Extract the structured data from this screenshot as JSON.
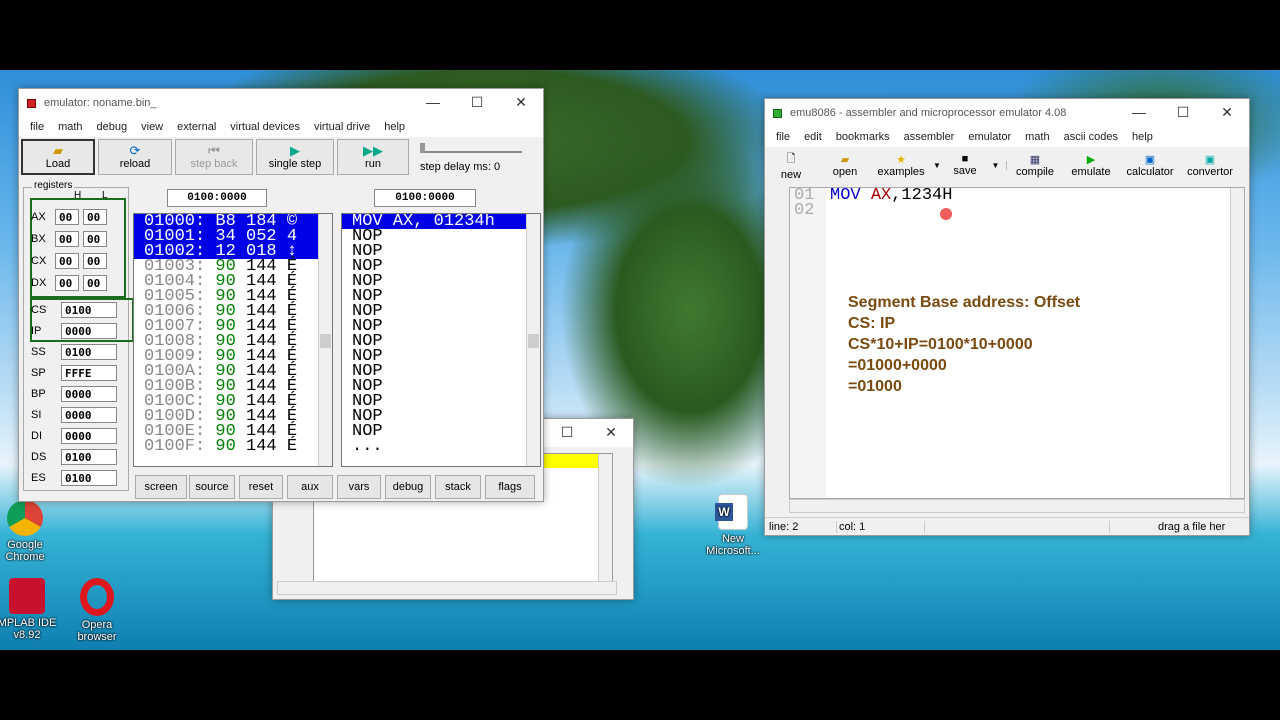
{
  "emulator": {
    "title": "emulator: noname.bin_",
    "menu": [
      "file",
      "math",
      "debug",
      "view",
      "external",
      "virtual devices",
      "virtual drive",
      "help"
    ],
    "toolbar": {
      "load": "Load",
      "reload": "reload",
      "step_back": "step back",
      "single_step": "single step",
      "run": "run",
      "step_delay": "step delay ms: 0"
    },
    "registers_label": "registers",
    "col_h": "H",
    "col_l": "L",
    "registers": {
      "ax": {
        "name": "AX",
        "h": "00",
        "l": "00"
      },
      "bx": {
        "name": "BX",
        "h": "00",
        "l": "00"
      },
      "cx": {
        "name": "CX",
        "h": "00",
        "l": "00"
      },
      "dx": {
        "name": "DX",
        "h": "00",
        "l": "00"
      },
      "cs": {
        "name": "CS",
        "v": "0100"
      },
      "ip": {
        "name": "IP",
        "v": "0000"
      },
      "ss": {
        "name": "SS",
        "v": "0100"
      },
      "sp": {
        "name": "SP",
        "v": "FFFE"
      },
      "bp": {
        "name": "BP",
        "v": "0000"
      },
      "si": {
        "name": "SI",
        "v": "0000"
      },
      "di": {
        "name": "DI",
        "v": "0000"
      },
      "ds": {
        "name": "DS",
        "v": "0100"
      },
      "es": {
        "name": "ES",
        "v": "0100"
      }
    },
    "mem_address": "0100:0000",
    "dis_address": "0100:0000",
    "memory": [
      {
        "addr": "01000:",
        "hex": "B8",
        "dec": "184",
        "ch": "©"
      },
      {
        "addr": "01001:",
        "hex": "34",
        "dec": "052",
        "ch": "4"
      },
      {
        "addr": "01002:",
        "hex": "12",
        "dec": "018",
        "ch": "↕"
      },
      {
        "addr": "01003:",
        "hex": "90",
        "dec": "144",
        "ch": "É"
      },
      {
        "addr": "01004:",
        "hex": "90",
        "dec": "144",
        "ch": "É"
      },
      {
        "addr": "01005:",
        "hex": "90",
        "dec": "144",
        "ch": "É"
      },
      {
        "addr": "01006:",
        "hex": "90",
        "dec": "144",
        "ch": "É"
      },
      {
        "addr": "01007:",
        "hex": "90",
        "dec": "144",
        "ch": "É"
      },
      {
        "addr": "01008:",
        "hex": "90",
        "dec": "144",
        "ch": "É"
      },
      {
        "addr": "01009:",
        "hex": "90",
        "dec": "144",
        "ch": "É"
      },
      {
        "addr": "0100A:",
        "hex": "90",
        "dec": "144",
        "ch": "É"
      },
      {
        "addr": "0100B:",
        "hex": "90",
        "dec": "144",
        "ch": "É"
      },
      {
        "addr": "0100C:",
        "hex": "90",
        "dec": "144",
        "ch": "É"
      },
      {
        "addr": "0100D:",
        "hex": "90",
        "dec": "144",
        "ch": "É"
      },
      {
        "addr": "0100E:",
        "hex": "90",
        "dec": "144",
        "ch": "É"
      },
      {
        "addr": "0100F:",
        "hex": "90",
        "dec": "144",
        "ch": "É"
      }
    ],
    "disassembly": [
      "MOV AX, 01234h",
      "NOP",
      "NOP",
      "NOP",
      "NOP",
      "NOP",
      "NOP",
      "NOP",
      "NOP",
      "NOP",
      "NOP",
      "NOP",
      "NOP",
      "NOP",
      "NOP",
      "..."
    ],
    "bottom_buttons": [
      "screen",
      "source",
      "reset",
      "aux",
      "vars",
      "debug",
      "stack",
      "flags"
    ]
  },
  "editor": {
    "title": "emu8086 - assembler and microprocessor emulator 4.08",
    "menu": [
      "file",
      "edit",
      "bookmarks",
      "assembler",
      "emulator",
      "math",
      "ascii codes",
      "help"
    ],
    "toolbar": {
      "new": "new",
      "open": "open",
      "examples": "examples",
      "save": "save",
      "compile": "compile",
      "emulate": "emulate",
      "calculator": "calculator",
      "convertor": "convertor"
    },
    "line_numbers": [
      "01",
      "02"
    ],
    "code": {
      "mov": "MOV",
      "reg": "AX",
      "rest": ",1234H"
    },
    "notes": [
      "Segment Base address: Offset",
      "CS: IP",
      "CS*10+IP=0100*10+0000",
      "=01000+0000",
      "=01000"
    ],
    "status": {
      "line": "line: 2",
      "col": "col: 1",
      "hint": "drag a file her"
    }
  },
  "desktop": {
    "chrome": "Google\nChrome",
    "mplab": "MPLAB IDE\nv8.92",
    "opera": "Opera\nbrowser",
    "word": "New\nMicrosoft..."
  }
}
